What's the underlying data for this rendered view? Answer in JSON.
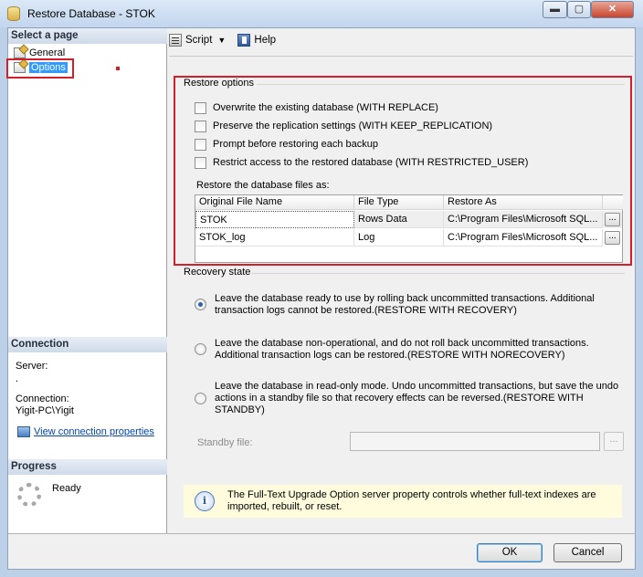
{
  "window": {
    "title": "Restore Database - STOK",
    "controls": {
      "minimize": "▬",
      "maximize": "▢",
      "close": "✕"
    }
  },
  "left_panel": {
    "select_page_header": "Select a page",
    "pages": [
      {
        "label": "General",
        "selected": false
      },
      {
        "label": "Options",
        "selected": true
      }
    ],
    "connection_header": "Connection",
    "server_label": "Server:",
    "server_value": ".",
    "connection_label": "Connection:",
    "connection_value": "Yigit-PC\\Yigit",
    "view_connection_link": "View connection properties",
    "progress_header": "Progress",
    "progress_status": "Ready"
  },
  "toolbar": {
    "script_label": "Script",
    "dropdown_arrow": "▼",
    "help_label": "Help"
  },
  "restore_options": {
    "header": "Restore options",
    "checkboxes": [
      {
        "label": "Overwrite the existing database (WITH REPLACE)",
        "checked": false
      },
      {
        "label": "Preserve the replication settings (WITH KEEP_REPLICATION)",
        "checked": false
      },
      {
        "label": "Prompt before restoring each backup",
        "checked": false
      },
      {
        "label": "Restrict access to the restored database (WITH RESTRICTED_USER)",
        "checked": false
      }
    ],
    "files_label": "Restore the database files as:",
    "grid": {
      "columns": [
        "Original File Name",
        "File Type",
        "Restore As"
      ],
      "rows": [
        {
          "original": "STOK",
          "type": "Rows Data",
          "restore_as": "C:\\Program Files\\Microsoft SQL...",
          "browse": "..."
        },
        {
          "original": "STOK_log",
          "type": "Log",
          "restore_as": "C:\\Program Files\\Microsoft SQL...",
          "browse": "..."
        }
      ]
    }
  },
  "recovery_state": {
    "header": "Recovery state",
    "options": [
      {
        "text": "Leave the database ready to use by rolling back uncommitted transactions. Additional transaction logs cannot be restored.(RESTORE WITH RECOVERY)",
        "selected": true
      },
      {
        "text": "Leave the database non-operational, and do not roll back uncommitted transactions. Additional transaction logs can be restored.(RESTORE WITH NORECOVERY)",
        "selected": false
      },
      {
        "text": "Leave the database in read-only mode. Undo uncommitted transactions, but save the undo actions in a standby file so that recovery effects can be reversed.(RESTORE WITH STANDBY)",
        "selected": false
      }
    ],
    "standby_label": "Standby file:",
    "standby_value": "",
    "standby_browse": "..."
  },
  "info_bar": {
    "icon": "i",
    "text": "The Full-Text Upgrade Option server property controls whether full-text indexes are imported, rebuilt, or reset."
  },
  "buttons": {
    "ok": "OK",
    "cancel": "Cancel"
  },
  "colors": {
    "highlight_red": "#d21f2a",
    "selection_blue": "#3399ff",
    "info_background": "#fefcdc",
    "link_blue": "#0645ad"
  }
}
